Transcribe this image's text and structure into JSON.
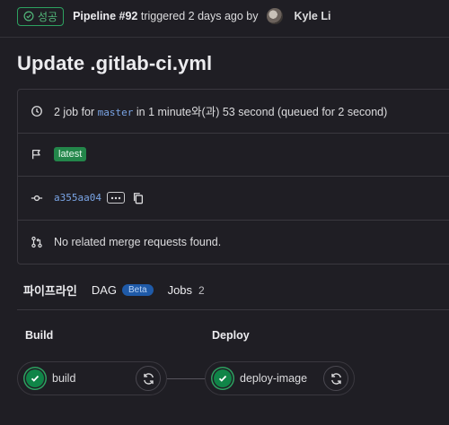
{
  "header": {
    "status": "성공",
    "pipeline_label": "Pipeline #92",
    "triggered_text": "triggered 2 days ago by",
    "author": "Kyle Li"
  },
  "title": "Update .gitlab-ci.yml",
  "info": {
    "jobs_prefix": "2 job for",
    "branch": "master",
    "duration_text": "in 1 minute와(과) 53 second (queued for 2 second)",
    "tag": "latest",
    "commit_sha": "a355aa04",
    "merge_requests": "No related merge requests found."
  },
  "tabs": {
    "pipeline": "파이프라인",
    "dag": "DAG",
    "dag_badge": "Beta",
    "jobs": "Jobs",
    "jobs_count": "2"
  },
  "stages": [
    {
      "name": "Build",
      "job": "build"
    },
    {
      "name": "Deploy",
      "job": "deploy-image"
    }
  ],
  "colors": {
    "success": "#108548",
    "link": "#7aa5e6",
    "beta": "#1f5aa8"
  }
}
